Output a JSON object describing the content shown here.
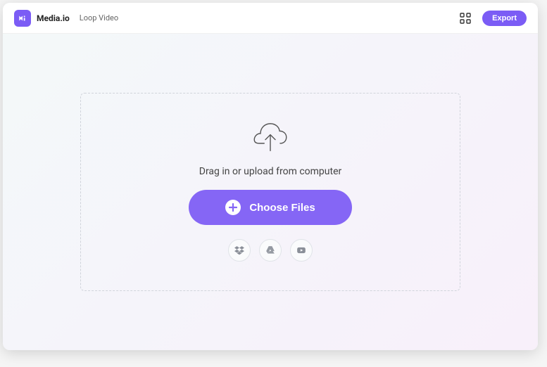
{
  "header": {
    "brand": "Media.io",
    "page_title": "Loop Video",
    "export_label": "Export"
  },
  "dropzone": {
    "instruction": "Drag in or upload from computer",
    "choose_label": "Choose Files"
  },
  "sources": {
    "dropbox": "dropbox",
    "gdrive": "google-drive",
    "youtube": "youtube"
  },
  "colors": {
    "accent": "#8566f5"
  }
}
